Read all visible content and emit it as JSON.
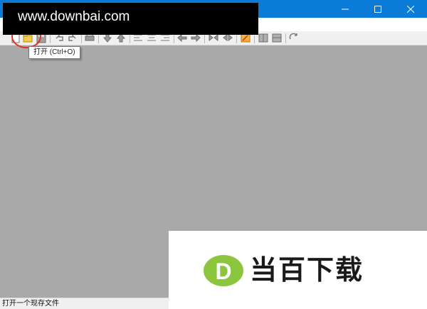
{
  "window": {
    "controls": {
      "minimize": "minimize-icon",
      "maximize": "maximize-icon",
      "close": "close-icon"
    },
    "titlebar_color": "#0a7bd7"
  },
  "toolbar": {
    "icons": [
      "new-icon",
      "open-icon",
      "save-icon",
      "undo-icon",
      "redo-icon",
      "print-icon",
      "move-down-icon",
      "move-up-icon",
      "align-left-icon",
      "align-center-icon",
      "align-right-icon",
      "arrow-left-icon",
      "arrow-right-icon",
      "expand-icon",
      "collapse-icon",
      "edit-icon",
      "merge-icon",
      "split-icon",
      "refresh-icon"
    ]
  },
  "tooltip": {
    "text": "打开 (Ctrl+O)"
  },
  "status": {
    "text": "打开一个现存文件"
  },
  "workspace": {
    "background": "#a9a9a9"
  },
  "watermarks": {
    "top_url": "www.downbai.com",
    "bottom_cn": "当百下载",
    "logo_letter": "D",
    "logo_color": "#8cc63f"
  }
}
